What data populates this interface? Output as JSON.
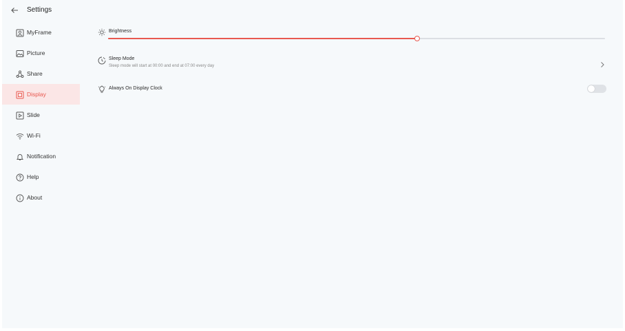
{
  "header": {
    "title": "Settings",
    "back_icon": "back-arrow-icon"
  },
  "sidebar": {
    "items": [
      {
        "label": "MyFrame",
        "icon": "portrait-frame-icon",
        "active": false
      },
      {
        "label": "Picture",
        "icon": "picture-icon",
        "active": false
      },
      {
        "label": "Share",
        "icon": "share-icon",
        "active": false
      },
      {
        "label": "Display",
        "icon": "display-icon",
        "active": true
      },
      {
        "label": "Slide",
        "icon": "slide-play-icon",
        "active": false
      },
      {
        "label": "Wi-Fi",
        "icon": "wifi-icon",
        "active": false
      },
      {
        "label": "Notification",
        "icon": "bell-icon",
        "active": false
      },
      {
        "label": "Help",
        "icon": "help-icon",
        "active": false
      },
      {
        "label": "About",
        "icon": "info-icon",
        "active": false
      }
    ]
  },
  "display": {
    "brightness": {
      "label": "Brightness",
      "icon": "sun-icon",
      "value_fraction": 0.62
    },
    "sleep_mode": {
      "label": "Sleep Mode",
      "description": "Sleep mode will start at 00:00 and end at 07:00 every day",
      "icon": "moon-clock-icon"
    },
    "always_on_clock": {
      "label": "Always On Display Clock",
      "icon": "bulb-icon",
      "enabled": false
    }
  },
  "colors": {
    "accent": "#e8584f",
    "active_bg": "#fbe6e6",
    "background": "#f6f9fb"
  }
}
